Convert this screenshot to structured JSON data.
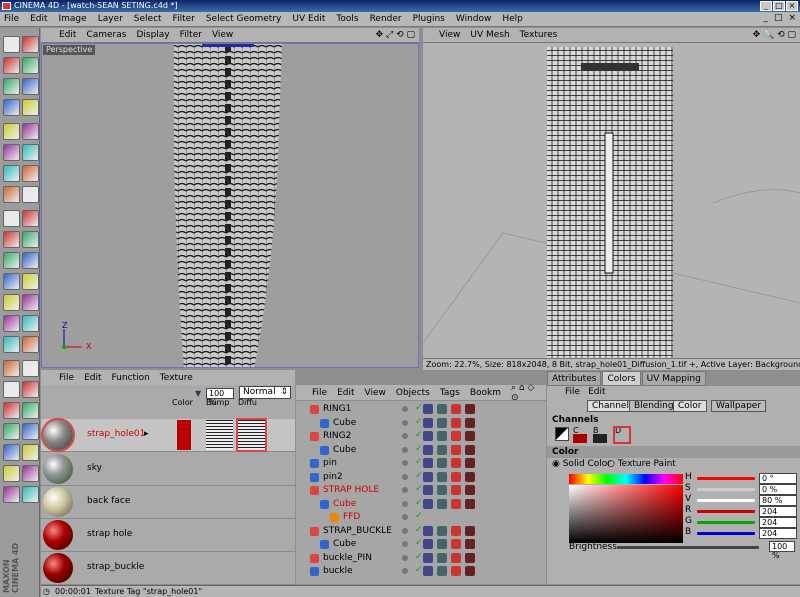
{
  "window": {
    "title": "CINEMA 4D - [watch-SEAN SETING.c4d *]",
    "controls": [
      "_",
      "□",
      "×"
    ]
  },
  "menubar": [
    "File",
    "Edit",
    "Image",
    "Layer",
    "Select",
    "Filter",
    "Select Geometry",
    "UV Edit",
    "Tools",
    "Render",
    "Plugins",
    "Window",
    "Help"
  ],
  "viewport": {
    "menu": [
      "Edit",
      "Cameras",
      "Display",
      "Filter",
      "View"
    ],
    "label": "Perspective",
    "axis": {
      "x": "X",
      "y": "Y",
      "z": "Z"
    }
  },
  "uv_view": {
    "menu": [
      "View",
      "UV Mesh",
      "Textures"
    ],
    "status": "Zoom: 22.7%, Size: 818x2048, 8 Bit, strap_hole01_Diffusion_1.tif +, Active Layer: Background"
  },
  "materials": {
    "menu": [
      "File",
      "Edit",
      "Function",
      "Texture"
    ],
    "zoom": "100 %",
    "mode": "Normal",
    "columns": [
      "Color",
      "Bump",
      "Diffu"
    ],
    "items": [
      {
        "name": "strap_hole01",
        "selected": true
      },
      {
        "name": "sky"
      },
      {
        "name": "back face"
      },
      {
        "name": "strap hole"
      },
      {
        "name": "strap_buckle"
      }
    ]
  },
  "objects": {
    "menu": [
      "File",
      "Edit",
      "View",
      "Objects",
      "Tags",
      "Bookm"
    ],
    "rows": [
      {
        "name": "RING1",
        "level": 0,
        "type": "null"
      },
      {
        "name": "Cube",
        "level": 1,
        "type": "cube"
      },
      {
        "name": "RING2",
        "level": 0,
        "type": "null"
      },
      {
        "name": "Cube",
        "level": 1,
        "type": "cube"
      },
      {
        "name": "pin",
        "level": 0,
        "type": "cyl"
      },
      {
        "name": "pin2",
        "level": 0,
        "type": "cyl"
      },
      {
        "name": "STRAP HOLE",
        "level": 0,
        "type": "null",
        "red": true
      },
      {
        "name": "Cube",
        "level": 1,
        "type": "cube",
        "red": true
      },
      {
        "name": "FFD",
        "level": 2,
        "type": "ffd",
        "red": true
      },
      {
        "name": "STRAP_BUCKLE",
        "level": 0,
        "type": "null"
      },
      {
        "name": "Cube",
        "level": 1,
        "type": "cube"
      },
      {
        "name": "buckle_PIN",
        "level": 0,
        "type": "null"
      },
      {
        "name": "buckle",
        "level": 0,
        "type": "cyl"
      }
    ]
  },
  "attributes": {
    "tabs": [
      "Attributes",
      "Colors",
      "UV Mapping"
    ],
    "menu": [
      "File",
      "Edit"
    ],
    "channels_label": "Channels",
    "subtabs": [
      "Channels",
      "Blending",
      "Color",
      "Wallpaper"
    ],
    "swatches": [
      "C",
      "B",
      "D"
    ],
    "color_label": "Color",
    "solid": "Solid Color",
    "texture": "Texture Paint",
    "fields": [
      {
        "k": "H",
        "v": "0 °",
        "color": "#ff0000"
      },
      {
        "k": "S",
        "v": "0 %",
        "color": "#cccccc"
      },
      {
        "k": "V",
        "v": "80 %",
        "color": "#ffffff"
      },
      {
        "k": "R",
        "v": "204",
        "color": "#cc0000"
      },
      {
        "k": "G",
        "v": "204",
        "color": "#00aa00"
      },
      {
        "k": "B",
        "v": "204",
        "color": "#0000cc"
      }
    ],
    "brightness_label": "Brightness",
    "brightness": "100 %"
  },
  "status": {
    "time": "00:00:01",
    "text": "Texture Tag \"strap_hole01\""
  }
}
